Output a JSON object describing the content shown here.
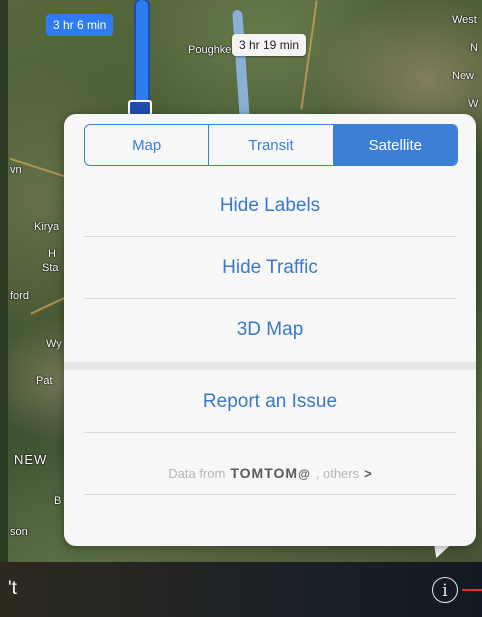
{
  "map": {
    "route_primary_time": "3 hr 6 min",
    "route_alt_time": "3 hr 19 min",
    "labels": [
      "Poughke",
      "West",
      "N",
      "New",
      "W",
      "vn",
      "Kirya",
      "H",
      "Sta",
      "ford",
      "Wy",
      "Pat",
      "NEW",
      "B",
      "son"
    ]
  },
  "popover": {
    "segments": [
      {
        "label": "Map",
        "active": false
      },
      {
        "label": "Transit",
        "active": false
      },
      {
        "label": "Satellite",
        "active": true
      }
    ],
    "options": {
      "hide_labels": "Hide Labels",
      "hide_traffic": "Hide Traffic",
      "map_3d": "3D Map",
      "report_issue": "Report an Issue"
    },
    "attribution": {
      "prefix": "Data from",
      "brand": "TOMTOM",
      "brand_mark": "@",
      "suffix": ", others",
      "chevron": ">"
    }
  },
  "bottom_bar": {
    "left_text": "'t",
    "info_button_glyph": "i"
  },
  "colors": {
    "accent": "#3c7fd6",
    "route_blue": "#2f7cf0"
  }
}
